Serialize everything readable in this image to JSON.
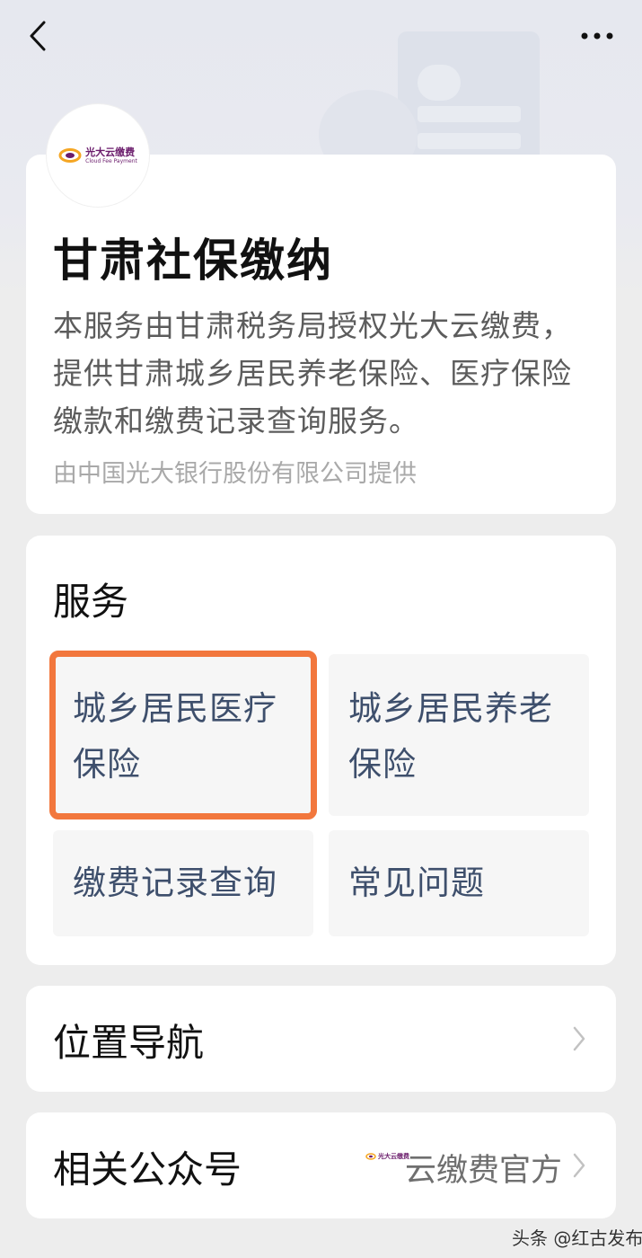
{
  "header": {
    "back_icon": "chevron-left-icon",
    "more_icon": "more-dots-icon"
  },
  "intro": {
    "logo": {
      "cn": "光大云缴费",
      "en": "Cloud Fee Payment"
    },
    "title": "甘肃社保缴纳",
    "description": "本服务由甘肃税务局授权光大云缴费，提供甘肃城乡居民养老保险、医疗保险缴款和缴费记录查询服务。",
    "provider": "由中国光大银行股份有限公司提供"
  },
  "services": {
    "heading": "服务",
    "items": [
      {
        "label": "城乡居民医疗保险",
        "highlighted": true
      },
      {
        "label": "城乡居民养老保险",
        "highlighted": false
      },
      {
        "label": "缴费记录查询",
        "highlighted": false
      },
      {
        "label": "常见问题",
        "highlighted": false
      }
    ],
    "highlight_color": "#f2773d"
  },
  "location": {
    "label": "位置导航",
    "chevron_icon": "chevron-right-icon"
  },
  "official_account": {
    "label": "相关公众号",
    "value": "云缴费官方",
    "mini_logo_text": "光大云缴费",
    "chevron_icon": "chevron-right-icon"
  },
  "watermark": "头条 @红古发布",
  "colors": {
    "page_bg": "#ededed",
    "tile_text": "#3e4f6c",
    "brand_purple": "#6a1b6b",
    "brand_orange": "#f5a623"
  }
}
